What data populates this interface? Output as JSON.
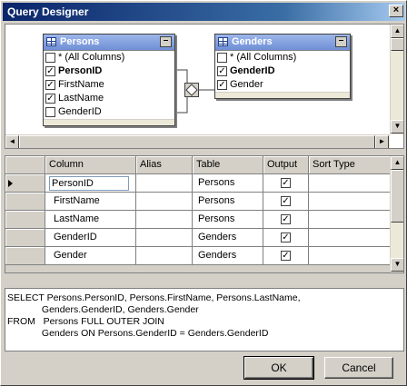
{
  "window": {
    "title": "Query Designer",
    "close_label": "×"
  },
  "diagram": {
    "tables": [
      {
        "name": "Persons",
        "columns": [
          {
            "label": "* (All Columns)",
            "checked": false,
            "bold": false
          },
          {
            "label": "PersonID",
            "checked": true,
            "bold": true
          },
          {
            "label": "FirstName",
            "checked": true,
            "bold": false
          },
          {
            "label": "LastName",
            "checked": true,
            "bold": false
          },
          {
            "label": "GenderID",
            "checked": false,
            "bold": false
          }
        ]
      },
      {
        "name": "Genders",
        "columns": [
          {
            "label": "* (All Columns)",
            "checked": false,
            "bold": false
          },
          {
            "label": "GenderID",
            "checked": true,
            "bold": true
          },
          {
            "label": "Gender",
            "checked": true,
            "bold": false
          }
        ]
      }
    ],
    "minimize_glyph": "–",
    "check_glyph": "✓"
  },
  "grid": {
    "headers": [
      "Column",
      "Alias",
      "Table",
      "Output",
      "Sort Type"
    ],
    "rows": [
      {
        "column": "PersonID",
        "alias": "",
        "table": "Persons",
        "output": "✓",
        "sort_type": "",
        "current": true
      },
      {
        "column": "FirstName",
        "alias": "",
        "table": "Persons",
        "output": "✓",
        "sort_type": ""
      },
      {
        "column": "LastName",
        "alias": "",
        "table": "Persons",
        "output": "✓",
        "sort_type": ""
      },
      {
        "column": "GenderID",
        "alias": "",
        "table": "Genders",
        "output": "✓",
        "sort_type": ""
      },
      {
        "column": "Gender",
        "alias": "",
        "table": "Genders",
        "output": "✓",
        "sort_type": ""
      }
    ]
  },
  "sql": {
    "lines": [
      "SELECT Persons.PersonID, Persons.FirstName, Persons.LastName,",
      "             Genders.GenderID, Genders.Gender",
      "FROM   Persons FULL OUTER JOIN",
      "             Genders ON Persons.GenderID = Genders.GenderID"
    ]
  },
  "buttons": {
    "ok": "OK",
    "cancel": "Cancel"
  },
  "scroll_glyphs": {
    "up": "▲",
    "down": "▼",
    "left": "◄",
    "right": "►"
  }
}
